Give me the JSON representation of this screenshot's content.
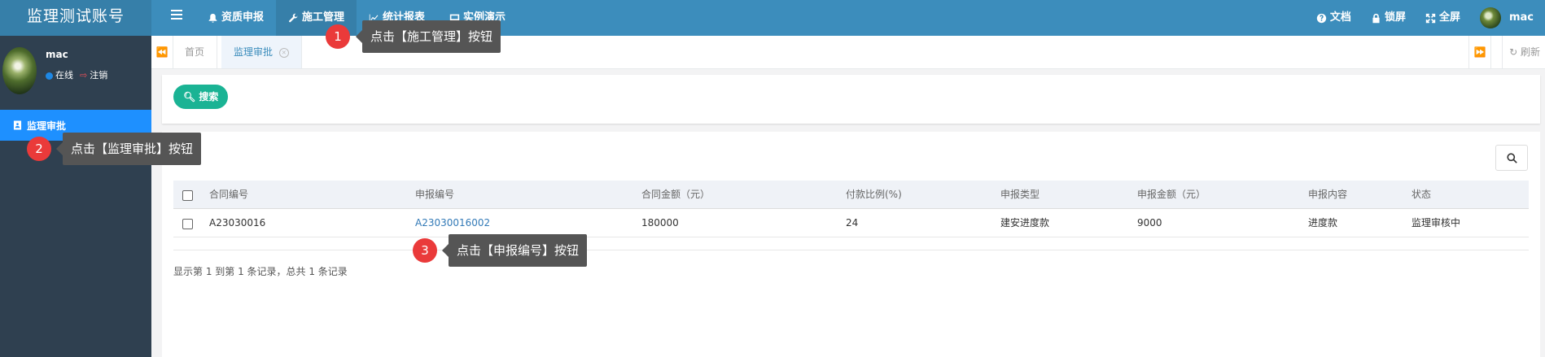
{
  "app": {
    "brand": "监理测试账号"
  },
  "topnav": {
    "items": [
      {
        "label": "资质申报",
        "icon": "bell-icon"
      },
      {
        "label": "施工管理",
        "icon": "wrench-icon"
      },
      {
        "label": "统计报表",
        "icon": "chart-icon"
      },
      {
        "label": "实例演示",
        "icon": "monitor-icon"
      }
    ],
    "right": [
      {
        "label": "文档",
        "icon": "question-circle-icon"
      },
      {
        "label": "锁屏",
        "icon": "lock-icon"
      },
      {
        "label": "全屏",
        "icon": "expand-icon"
      }
    ],
    "user": "mac"
  },
  "sidebar": {
    "username": "mac",
    "status_online": "在线",
    "status_logout": "注销",
    "menu": [
      {
        "label": "监理审批",
        "icon": "contact-card-icon"
      }
    ]
  },
  "tabs": {
    "items": [
      {
        "label": "首页"
      },
      {
        "label": "监理审批"
      }
    ],
    "refresh": "刷新"
  },
  "search": {
    "button": "搜索"
  },
  "table": {
    "columns": [
      "合同编号",
      "申报编号",
      "合同金额（元）",
      "付款比例(%)",
      "申报类型",
      "申报金额（元）",
      "申报内容",
      "状态"
    ],
    "rows": [
      {
        "contract_no": "A23030016",
        "report_no": "A23030016002",
        "contract_amount": "180000",
        "pay_ratio": "24",
        "report_type": "建安进度款",
        "report_amount": "9000",
        "report_content": "进度款",
        "status": "监理审核中"
      }
    ],
    "pager": "显示第 1 到第 1 条记录，总共 1 条记录"
  },
  "callouts": [
    {
      "num": "1",
      "text": "点击【施工管理】按钮"
    },
    {
      "num": "2",
      "text": "点击【监理审批】按钮"
    },
    {
      "num": "3",
      "text": "点击【申报编号】按钮"
    }
  ],
  "colors": {
    "topbar": "#3c8dbc",
    "sidebar": "#2f4050",
    "sidebar_active": "#1e90ff",
    "search_button": "#1ab394",
    "callout_badge": "#ea3a3a"
  }
}
